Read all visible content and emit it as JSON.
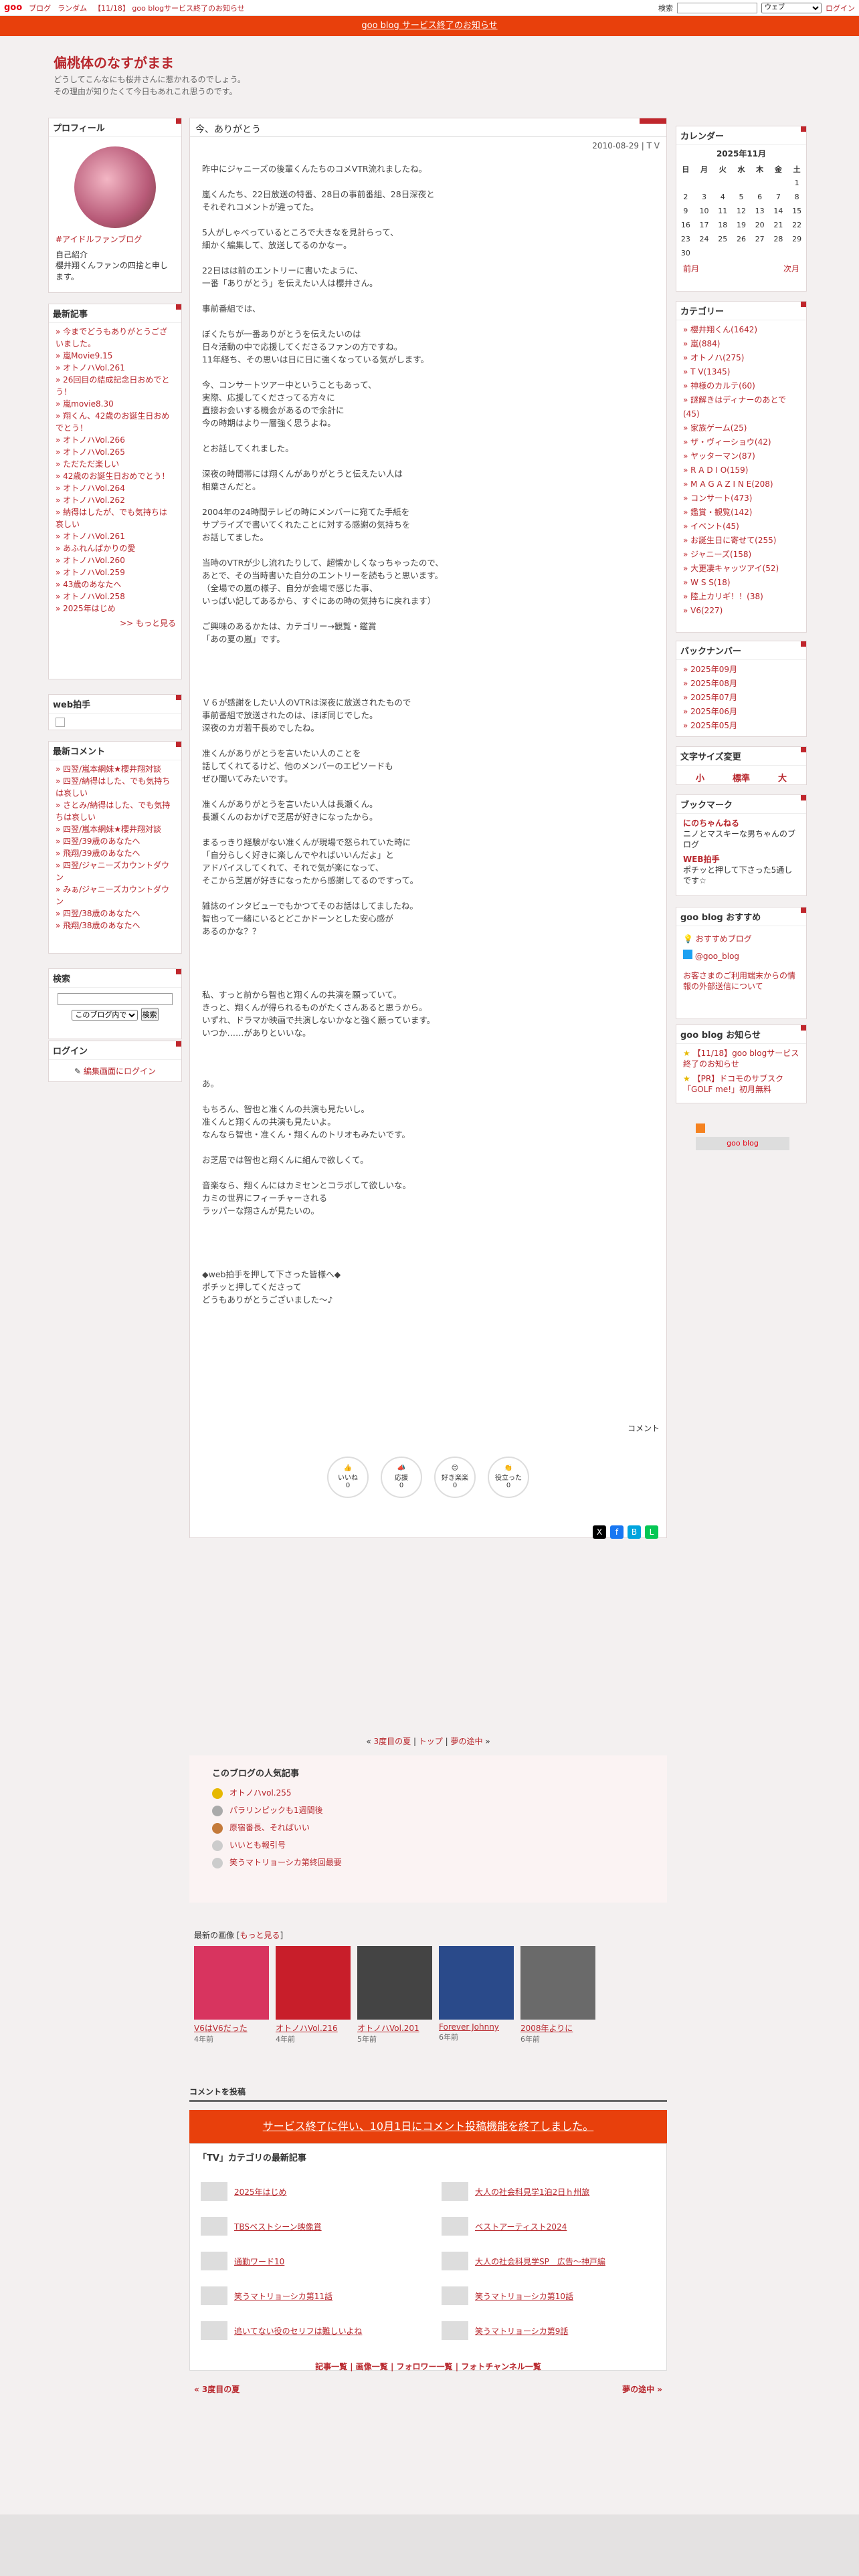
{
  "header": {
    "logo": "goo",
    "links": [
      "ブログ",
      "ランダム",
      "【11/18】 goo blogサービス終了のお知らせ"
    ],
    "search_label": "検索",
    "search_scope": "ウェブ",
    "login": "ログイン"
  },
  "banner": "goo blog サービス終了のお知らせ",
  "blog": {
    "title": "偏桃体のなすがまま",
    "desc1": "どうしてこんなにも桜井さんに惹かれるのでしょう。",
    "desc2": "その理由が知りたくて今日もあれこれ思うのです。"
  },
  "profile": {
    "heading": "プロフィール",
    "tag": "#アイドルファンブログ",
    "intro_label": "自己紹介",
    "intro": "櫻井翔くんファンの四捨と申します。"
  },
  "recent": {
    "heading": "最新記事",
    "items": [
      "今までどうもありがとうございました。",
      "嵐Movie9.15",
      "オトノハVol.261",
      "26回目の結成記念日おめでとう！",
      "嵐movie8.30",
      "翔くん、42歳のお誕生日おめでとう！",
      "オトノハVol.266",
      "オトノハVol.265",
      "ただただ楽しい",
      "42歳のお誕生日おめでとう！",
      "オトノハVol.264",
      "オトノハVol.262",
      "納得はしたが、でも気持ちは哀しい",
      "オトノハVol.261",
      "あふれんばかりの愛",
      "オトノハVol.260",
      "オトノハVol.259",
      "43歳のあなたへ",
      "オトノハVol.258",
      "2025年はじめ"
    ],
    "more": ">> もっと見る"
  },
  "webclap": {
    "heading": "web拍手"
  },
  "comments": {
    "heading": "最新コメント",
    "items": [
      "四翌/嵐本網妹★櫻井翔対談",
      "四翌/納得はした、でも気持ちは哀しい",
      "さとみ/納得はした、でも気持ちは哀しい",
      "四翌/嵐本網妹★櫻井翔対談",
      "四翌/39歳のあなたへ",
      "飛翔/39歳のあなたへ",
      "四翌/ジャニーズカウントダウン",
      "みぁ/ジャニーズカウントダウン",
      "四翌/38歳のあなたへ",
      "飛翔/38歳のあなたへ"
    ]
  },
  "search": {
    "heading": "検索",
    "scope": "このブログ内で",
    "button": "検索"
  },
  "login": {
    "heading": "ログイン",
    "link": "編集画面にログイン"
  },
  "post": {
    "title": "今、ありがとう",
    "date": "2010-08-29 | T V",
    "body": "昨中にジャニーズの後輩くんたちのコメVTR流れましたね。\n\n嵐くんたち、22日放送の特番、28日の事前番組、28日深夜と\nそれぞれコメントが違ってた。\n\n5人がしゃべっているところで大きなを見計らって、\n細かく編集して、放送してるのかなー。\n\n22日はは前のエントリーに書いたように、\n一番「ありがとう」を伝えたい人は櫻井さん。\n\n事前番組では、\n\nぼくたちが一番ありがとうを伝えたいのは\n日々活動の中で応援してくださるファンの方ですね。\n11年経ち、その思いは日に日に強くなっている気がします。\n\n今、コンサートツアー中ということもあって、\n実際、応援してくださってる方々に\n直接お会いする機会があるので余計に\n今の時期はより一層強く思うよね。\n\nとお話してくれました。\n\n深夜の時間帯には翔くんがありがとうと伝えたい人は\n相葉さんだと。\n\n2004年の24時間テレビの時にメンバーに宛てた手紙を\nサプライズで書いてくれたことに対する感謝の気持ちを\nお話してました。\n\n当時のVTRが少し流れたりして、超懐かしくなっちゃったので、\nあとで、その当時書いた自分のエントリーを読もうと思います。\n（全場での嵐の様子、自分が会場で感じた事、\nいっぱい記してあるから、すぐにあの時の気持ちに戻れます）\n\nご興味のあるかたは、カテゴリー→観覧・鑑賞\n「あの夏の嵐」です。\n\n\n\n\nＶ６が感謝をしたい人のVTRは深夜に放送されたもので\n事前番組で放送されたのは、ほぼ同じでした。\n深夜のカガ若干長めでしたね。\n\n准くんがありがとうを言いたい人のことを\n話してくれてるけど、他のメンバーのエピソードも\nぜひ聞いてみたいです。\n\n准くんがありがとうを言いたい人は長瀬くん。\n長瀬くんのおかげで芝居が好きになったから。\n\nまるっきり経験がない准くんが現場で怒られていた時に\n「自分らしく好きに楽しんでやればいいんだよ」と\nアドバイスしてくれて、それで気が楽になって、\nそこから芝居が好きになったから感謝してるのですって。\n\n雑誌のインタビューでもかつてそのお話はしてましたね。\n智也って一緒にいるとどこかドーンとした安心感が\nあるのかな？？\n\n\n\n\n私、すっと前から智也と翔くんの共演を願っていて。\nきっと、翔くんが得られるものがたくさんあると思うから。\nいずれ、ドラマか映画で共演しないかなと強く願っています。\nいつか……がありといいな。\n\n\n\nあ。\n\nもちろん、智也と准くんの共演も見たいし。\n准くんと翔くんの共演も見たいよ。\nなんなら智也・准くん・翔くんのトリオもみたいです。\n\nお芝居では智也と翔くんに組んで欲しくて。\n\n音楽なら、翔くんにはカミセンとコラボして欲しいな。\nカミの世界にフィーチャーされる\nラッパーな翔さんが見たいの。\n\n\n\n\n◆web拍手を押して下さった皆様へ◆\nポチッと押してくださって\nどうもありがとうございました〜♪",
    "comment_label": "コメント",
    "reactions": [
      {
        "label": "いいね",
        "count": "0"
      },
      {
        "label": "応援",
        "count": "0"
      },
      {
        "label": "好き楽楽",
        "count": "0"
      },
      {
        "label": "役立った",
        "count": "0"
      }
    ]
  },
  "calendar": {
    "heading": "カレンダー",
    "month": "2025年11月",
    "dow": [
      "日",
      "月",
      "火",
      "水",
      "木",
      "金",
      "土"
    ],
    "rows": [
      [
        "",
        "",
        "",
        "",
        "",
        "",
        "1"
      ],
      [
        "2",
        "3",
        "4",
        "5",
        "6",
        "7",
        "8"
      ],
      [
        "9",
        "10",
        "11",
        "12",
        "13",
        "14",
        "15"
      ],
      [
        "16",
        "17",
        "18",
        "19",
        "20",
        "21",
        "22"
      ],
      [
        "23",
        "24",
        "25",
        "26",
        "27",
        "28",
        "29"
      ],
      [
        "30",
        "",
        "",
        "",
        "",
        "",
        ""
      ]
    ],
    "prev": "前月",
    "next": "次月"
  },
  "categories": {
    "heading": "カテゴリー",
    "items": [
      "櫻井翔くん(1642)",
      "嵐(884)",
      "オトノハ(275)",
      "T V(1345)",
      "神様のカルテ(60)",
      "謎解きはディナーのあとで(45)",
      "家族ゲーム(25)",
      "ザ・ヴィーショウ(42)",
      "ヤッターマン(87)",
      "R A D I O(159)",
      "M A G A Z I N E(208)",
      "コンサート(473)",
      "鑑賞・観覧(142)",
      "イベント(45)",
      "お誕生日に寄せて(255)",
      "ジャニーズ(158)",
      "大更凄キャッツアイ(52)",
      "W S S(18)",
      "陸上カリギ！！(38)",
      "V6(227)"
    ]
  },
  "backnumber": {
    "heading": "バックナンバー",
    "items": [
      "2025年09月",
      "2025年08月",
      "2025年07月",
      "2025年06月",
      "2025年05月"
    ]
  },
  "fontsize": {
    "heading": "文字サイズ変更",
    "options": [
      "小",
      "標準",
      "大"
    ]
  },
  "bookmark": {
    "heading": "ブックマーク",
    "items": [
      {
        "title": "にのちゃんねる",
        "desc": "ニノとマスキーな男ちゃんのブログ"
      },
      {
        "title": "WEB拍手",
        "desc": "ポチッと押して下さった5通しです☆"
      }
    ]
  },
  "goorecommend": {
    "heading": "goo blog おすすめ",
    "items": [
      "おすすめブログ",
      "@goo_blog"
    ],
    "note": "お客さまのご利用端末からの情報の外部送信について"
  },
  "goonotice": {
    "heading": "goo blog お知らせ",
    "items": [
      "【11/18】goo blogサービス終了のお知らせ",
      "【PR】ドコモのサブスク「GOLF me!」初月無料"
    ]
  },
  "goolink": "goo blog",
  "pagenav": {
    "prev": "3度目の夏",
    "top": "トップ",
    "next": "夢の途中"
  },
  "popular": {
    "heading": "このブログの人気記事",
    "items": [
      "オトノハvol.255",
      "パラリンピックも1週間後",
      "原宿番長、そればいい",
      "いいとも報引号",
      "笑うマトリョーシカ第終回最要"
    ]
  },
  "images": {
    "heading": "最新の画像",
    "more": "もっと見る",
    "items": [
      {
        "cap": "V6はV6だった",
        "age": "4年前"
      },
      {
        "cap": "オトノハVol.216",
        "age": "4年前"
      },
      {
        "cap": "オトノハVol.201",
        "age": "5年前"
      },
      {
        "cap": "Forever Johnny",
        "age": "6年前"
      },
      {
        "cap": "2008年よりに",
        "age": "6年前"
      }
    ]
  },
  "commentform": {
    "heading": "コメントを投稿",
    "closed": "サービス終了に伴い、10月1日にコメント投稿機能を終了しました。"
  },
  "related": {
    "heading": "「TV」カテゴリの最新記事",
    "items": [
      "2025年はじめ",
      "大人の社会科見学1泊2日ｈ州旅",
      "TBSベストシーン映像賞",
      "ベストアーティスト2024",
      "通勤ワード10",
      "大人の社会科見学SP　広告～神戸編",
      "笑うマトリョーシカ第11話",
      "笑うマトリョーシカ第10話",
      "追いてない役のセリフは難しいよね",
      "笑うマトリョーシカ第9話"
    ]
  },
  "footer": {
    "links": "記事一覧 | 画像一覧 | フォロワー一覧 | フォトチャンネル一覧",
    "prev": "« 3度目の夏",
    "next": "夢の途中 »"
  }
}
